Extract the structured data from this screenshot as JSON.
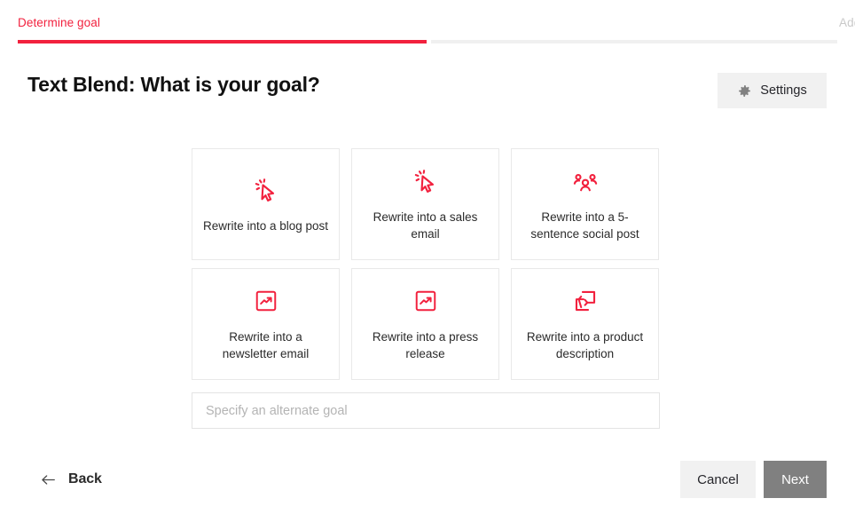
{
  "accent_color": "#f2213e",
  "stepper": {
    "steps": [
      {
        "label": "Determine goal",
        "state": "active"
      },
      {
        "label": "Add content",
        "state": "inactive"
      }
    ]
  },
  "header": {
    "title": "Text Blend: What is your goal?",
    "settings_label": "Settings",
    "settings_icon": "gear-icon"
  },
  "goals": [
    {
      "label": "Rewrite into a blog post",
      "icon": "cursor-click-icon"
    },
    {
      "label": "Rewrite into a sales email",
      "icon": "cursor-click-icon"
    },
    {
      "label": "Rewrite into a 5-sentence social post",
      "icon": "users-group-icon"
    },
    {
      "label": "Rewrite into a newsletter email",
      "icon": "trending-up-square-icon"
    },
    {
      "label": "Rewrite into a press release",
      "icon": "trending-up-square-icon"
    },
    {
      "label": "Rewrite into a product description",
      "icon": "repeat-exchange-icon"
    }
  ],
  "alternate_goal": {
    "placeholder": "Specify an alternate goal",
    "value": ""
  },
  "footer": {
    "back_label": "Back",
    "back_icon": "arrow-left-icon",
    "cancel_label": "Cancel",
    "next_label": "Next"
  }
}
